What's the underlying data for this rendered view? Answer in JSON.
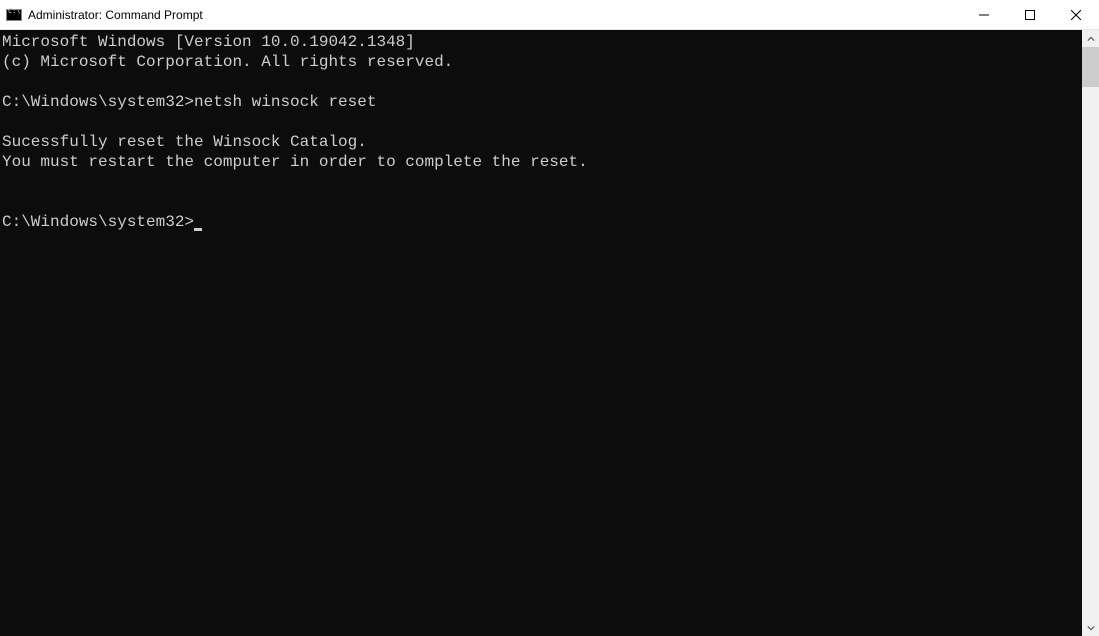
{
  "titlebar": {
    "title": "Administrator: Command Prompt"
  },
  "terminal": {
    "lines": [
      "Microsoft Windows [Version 10.0.19042.1348]",
      "(c) Microsoft Corporation. All rights reserved.",
      "",
      "C:\\Windows\\system32>netsh winsock reset",
      "",
      "Sucessfully reset the Winsock Catalog.",
      "You must restart the computer in order to complete the reset.",
      "",
      ""
    ],
    "prompt": "C:\\Windows\\system32>"
  }
}
